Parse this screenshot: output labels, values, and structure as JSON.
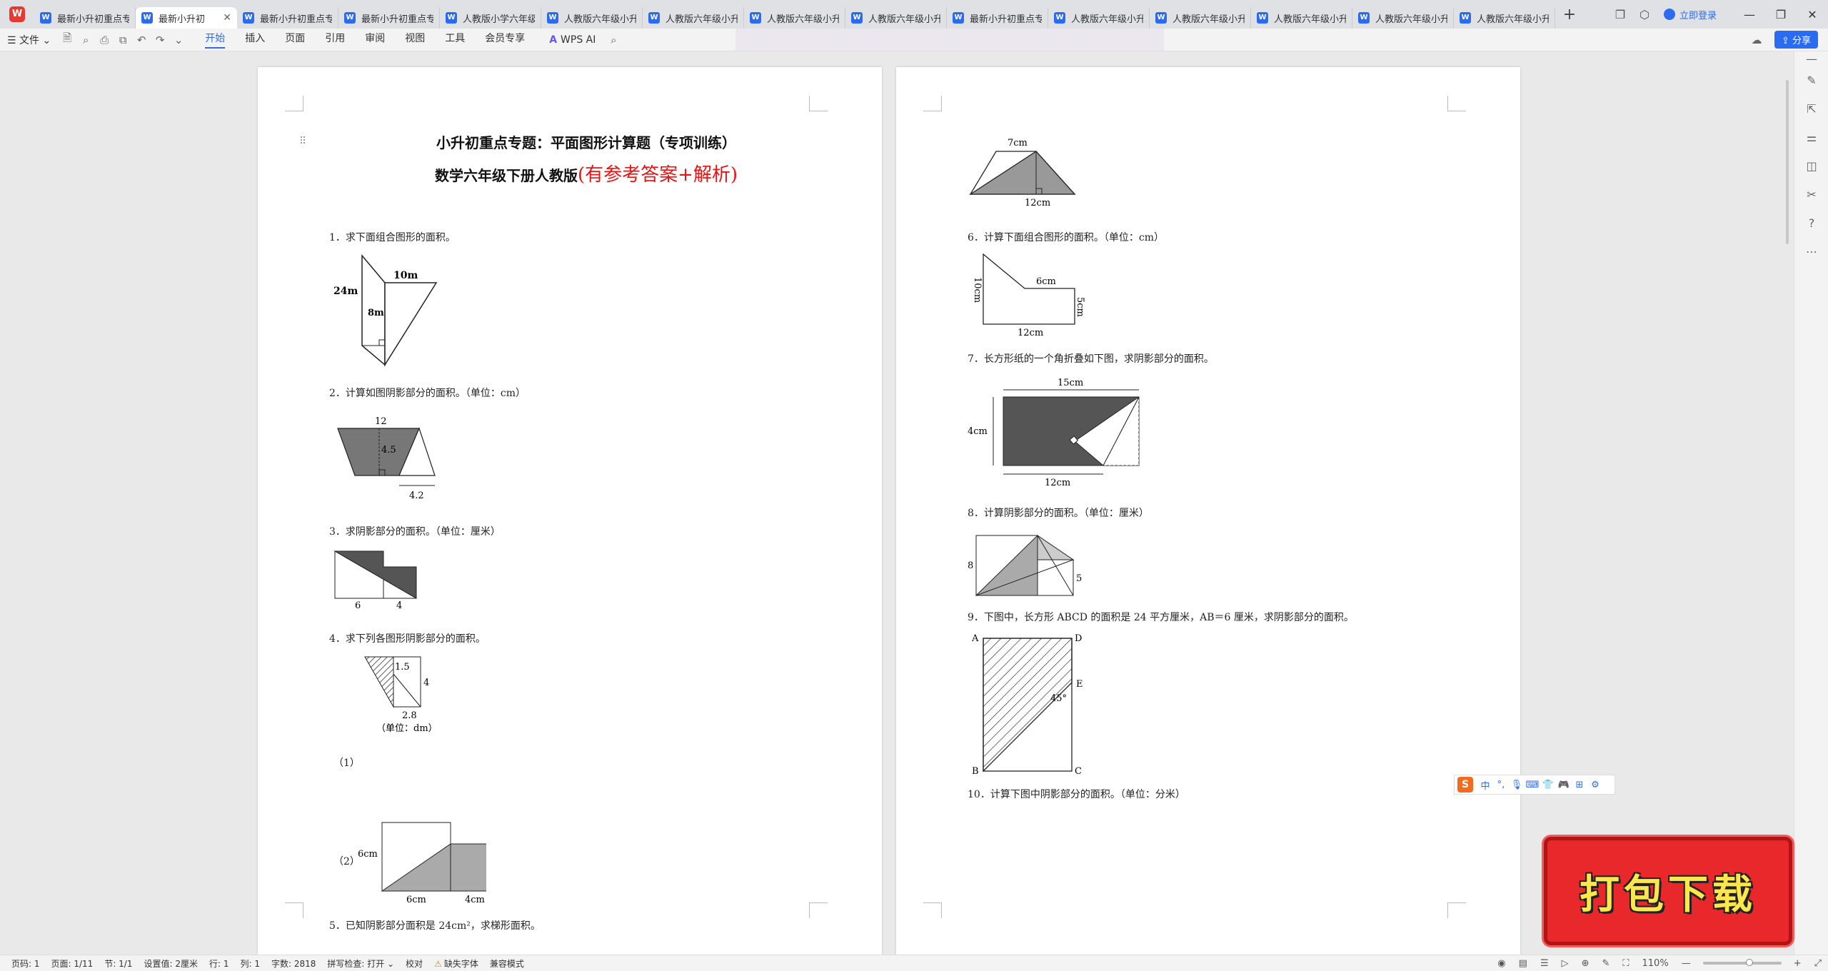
{
  "tabbar": {
    "tabs": [
      {
        "label": "最新小升初重点专"
      },
      {
        "label": "最新小升初",
        "active": true
      },
      {
        "label": "最新小升初重点专"
      },
      {
        "label": "最新小升初重点专"
      },
      {
        "label": "人教版小学六年级"
      },
      {
        "label": "人教版六年级小升"
      },
      {
        "label": "人教版六年级小升"
      },
      {
        "label": "人教版六年级小升"
      },
      {
        "label": "人教版六年级小升"
      },
      {
        "label": "最新小升初重点专"
      },
      {
        "label": "人教版六年级小升"
      },
      {
        "label": "人教版六年级小升"
      },
      {
        "label": "人教版六年级小升"
      },
      {
        "label": "人教版六年级小升"
      },
      {
        "label": "人教版六年级小升"
      }
    ],
    "login_label": "立即登录"
  },
  "ribbon": {
    "file_label": "文件",
    "menus": [
      "开始",
      "插入",
      "页面",
      "引用",
      "审阅",
      "视图",
      "工具",
      "会员专享"
    ],
    "wps_ai_label": "WPS AI",
    "share_label": "分享"
  },
  "doc": {
    "title": "小升初重点专题：平面图形计算题（专项训练）",
    "subtitle_black": "数学六年级下册人教版",
    "subtitle_red": "(有参考答案+解析)",
    "questions": {
      "q1": "1．求下面组合图形的面积。",
      "q2": "2．计算如图阴影部分的面积。（单位：cm）",
      "q3": "3．求阴影部分的面积。（单位：厘米）",
      "q4": "4．求下列各图形阴影部分的面积。",
      "q5": "5．已知阴影部分面积是 24cm²，求梯形面积。",
      "q6": "6．计算下面组合图形的面积。（单位：cm）",
      "q7": "7．长方形纸的一个角折叠如下图，求阴影部分的面积。",
      "q8": "8．计算阴影部分的面积。（单位：厘米）",
      "q9": "9．下图中，长方形 ABCD 的面积是 24 平方厘米，AB＝6 厘米，求阴影部分的面积。",
      "q10": "10．计算下图中阴影部分的面积。（单位：分米）"
    },
    "fig_labels": {
      "f1_a": "24m",
      "f1_b": "10m",
      "f1_c": "8m",
      "f2_a": "12",
      "f2_b": "4.5",
      "f2_c": "4.2",
      "f3_a": "6",
      "f3_b": "4",
      "f4_1": "（1）",
      "f4_a": "1.5",
      "f4_b": "4",
      "f4_c": "2.8",
      "f4_unit": "（单位：dm）",
      "f4_2": "（2）",
      "f4_d": "6cm",
      "f4_e": "4cm",
      "f4_f": "6cm",
      "f4_g": "4cm",
      "f5_a": "7cm",
      "f5_b": "12cm",
      "f6_a": "10cm",
      "f6_b": "6cm",
      "f6_c": "5cm",
      "f6_d": "12cm",
      "f7_a": "15cm",
      "f7_b": "4cm",
      "f7_c": "12cm",
      "f8_a": "8",
      "f8_b": "5",
      "f9_A": "A",
      "f9_D": "D",
      "f9_E": "E",
      "f9_B": "B",
      "f9_C": "C",
      "f9_ang": "45°"
    }
  },
  "status": {
    "page": "页码: 1",
    "pages": "页面: 1/11",
    "section": "节: 1/1",
    "setting": "设置值: 2厘米",
    "row": "行: 1",
    "col": "列: 1",
    "words": "字数: 2818",
    "spell": "拼写检查: 打开",
    "proof": "校对",
    "missing_font": "缺失字体",
    "compat": "兼容模式",
    "zoom": "110%"
  },
  "banner": {
    "label": "打包下载"
  },
  "ime": {
    "logo": "S",
    "mode": "中"
  }
}
